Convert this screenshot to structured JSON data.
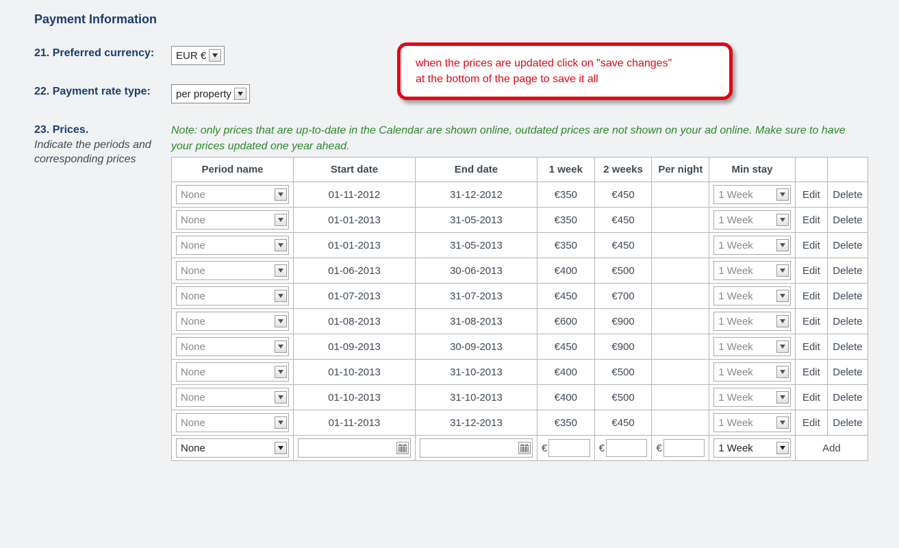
{
  "section": {
    "title": "Payment Information"
  },
  "fields": {
    "currency": {
      "label": "21. Preferred currency:",
      "value": "EUR €"
    },
    "rateType": {
      "label": "22. Payment rate type:",
      "value": "per property"
    },
    "prices": {
      "label": "23. Prices.",
      "sub": "Indicate the periods and corresponding prices"
    }
  },
  "callout": {
    "line1": "when the prices are updated click on \"save changes\"",
    "line2": "at the bottom of the page to save it all"
  },
  "note": "Note: only prices that are up-to-date in the Calendar are shown online, outdated prices are not shown on your ad online. Make sure to have your prices updated one year ahead.",
  "table": {
    "headers": {
      "period": "Period name",
      "start": "Start date",
      "end": "End date",
      "week1": "1 week",
      "week2": "2 weeks",
      "night": "Per night",
      "minstay": "Min stay"
    },
    "actions": {
      "edit": "Edit",
      "delete": "Delete",
      "add": "Add"
    },
    "defaults": {
      "period": "None",
      "minstay": "1 Week",
      "currencySymbol": "€"
    },
    "rows": [
      {
        "period": "None",
        "start": "01-11-2012",
        "end": "31-12-2012",
        "week1": "€350",
        "week2": "€450",
        "night": "",
        "minstay": "1 Week"
      },
      {
        "period": "None",
        "start": "01-01-2013",
        "end": "31-05-2013",
        "week1": "€350",
        "week2": "€450",
        "night": "",
        "minstay": "1 Week"
      },
      {
        "period": "None",
        "start": "01-01-2013",
        "end": "31-05-2013",
        "week1": "€350",
        "week2": "€450",
        "night": "",
        "minstay": "1 Week"
      },
      {
        "period": "None",
        "start": "01-06-2013",
        "end": "30-06-2013",
        "week1": "€400",
        "week2": "€500",
        "night": "",
        "minstay": "1 Week"
      },
      {
        "period": "None",
        "start": "01-07-2013",
        "end": "31-07-2013",
        "week1": "€450",
        "week2": "€700",
        "night": "",
        "minstay": "1 Week"
      },
      {
        "period": "None",
        "start": "01-08-2013",
        "end": "31-08-2013",
        "week1": "€600",
        "week2": "€900",
        "night": "",
        "minstay": "1 Week"
      },
      {
        "period": "None",
        "start": "01-09-2013",
        "end": "30-09-2013",
        "week1": "€450",
        "week2": "€900",
        "night": "",
        "minstay": "1 Week"
      },
      {
        "period": "None",
        "start": "01-10-2013",
        "end": "31-10-2013",
        "week1": "€400",
        "week2": "€500",
        "night": "",
        "minstay": "1 Week"
      },
      {
        "period": "None",
        "start": "01-10-2013",
        "end": "31-10-2013",
        "week1": "€400",
        "week2": "€500",
        "night": "",
        "minstay": "1 Week"
      },
      {
        "period": "None",
        "start": "01-11-2013",
        "end": "31-12-2013",
        "week1": "€350",
        "week2": "€450",
        "night": "",
        "minstay": "1 Week"
      }
    ]
  }
}
